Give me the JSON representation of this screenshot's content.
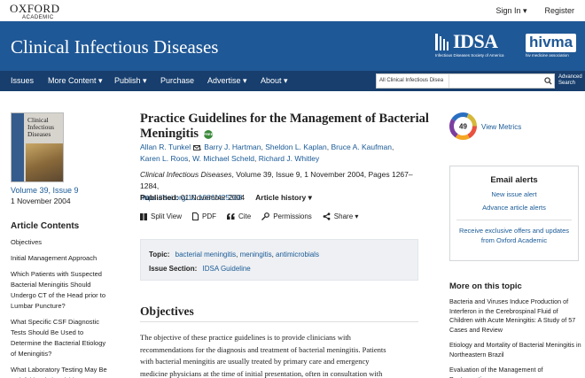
{
  "topbar": {
    "logo_main": "OXFORD",
    "logo_sub": "ACADEMIC",
    "sign_in": "Sign In ▾",
    "register": "Register"
  },
  "banner": {
    "journal_title": "Clinical Infectious Diseases",
    "idsa_text": "IDSA",
    "idsa_subtitle": "Infectious Diseases Society of America",
    "hivma_text": "hivma",
    "hivma_subtitle": "hiv medicine association"
  },
  "nav": {
    "items": [
      "Issues",
      "More Content ▾",
      "Publish ▾",
      "Purchase",
      "Advertise ▾",
      "About ▾"
    ],
    "search_scope": "All Clinical Infectious Disea",
    "search_value": "",
    "advanced_search_line1": "Advanced",
    "advanced_search_line2": "Search"
  },
  "left": {
    "cover_title": "Clinical Infectious Diseases",
    "volume_issue": "Volume 39, Issue 9",
    "pub_date": "1 November 2004",
    "contents_heading": "Article Contents",
    "contents": [
      "Objectives",
      "Initial Management Approach",
      "Which Patients with Suspected Bacterial Meningitis Should Undergo CT of the Head prior to Lumbar Puncture?",
      "What Specific CSF Diagnostic Tests Should Be Used to Determine the Bacterial Etiology of Meningitis?",
      "What Laboratory Testing May Be Helpful in Distinguishing"
    ]
  },
  "article": {
    "title": "Practice Guidelines for the Management of Bacterial Meningitis",
    "free_badge": "FREE",
    "authors": [
      "Allan R. Tunkel",
      "Barry J. Hartman",
      "Sheldon L. Kaplan",
      "Bruce A. Kaufman",
      "Karen L. Roos",
      "W. Michael Scheld",
      "Richard J. Whitley"
    ],
    "journal_name": "Clinical Infectious Diseases",
    "citation_rest": ", Volume 39, Issue 9, 1 November 2004, Pages 1267–1284,",
    "doi": "https://doi.org/10.1086/425368",
    "published_label": "Published:",
    "published_date": "01 November 2004",
    "history_label": "Article history ▾",
    "actions": [
      "Split View",
      "PDF",
      "Cite",
      "Permissions",
      "Share ▾"
    ],
    "topic_label": "Topic:",
    "topics": [
      "bacterial meningitis",
      "meningitis",
      "antimicrobials"
    ],
    "issue_section_label": "Issue Section:",
    "issue_section": "IDSA Guideline",
    "section_heading": "Objectives",
    "body_lines": [
      "The objective of these practice guidelines is to provide clinicians with",
      "recommendations for the diagnosis and treatment of bacterial meningitis. Patients",
      "with bacterial meningitis are usually treated by primary care and emergency",
      "medicine physicians at the time of initial presentation, often in consultation with"
    ]
  },
  "right": {
    "altmetric_score": "49",
    "view_metrics": "View Metrics",
    "alerts_title": "Email alerts",
    "new_issue_alert": "New issue alert",
    "advance_article_alerts": "Advance article alerts",
    "offers": "Receive exclusive offers and updates from Oxford Academic",
    "more_heading": "More on this topic",
    "more_items": [
      "Bacteria and Viruses Induce Production of Interferon in the Cerebrospinal Fluid of Children with Acute Meningitis: A Study of 57 Cases and Review",
      "Etiology and Mortality of Bacterial Meningitis in Northeastern Brazil",
      "Evaluation of the Management of Postoperative"
    ]
  },
  "colors": {
    "banner_blue": "#1f5896",
    "nav_navy": "#173e6d",
    "link_blue": "#1a5a96"
  }
}
